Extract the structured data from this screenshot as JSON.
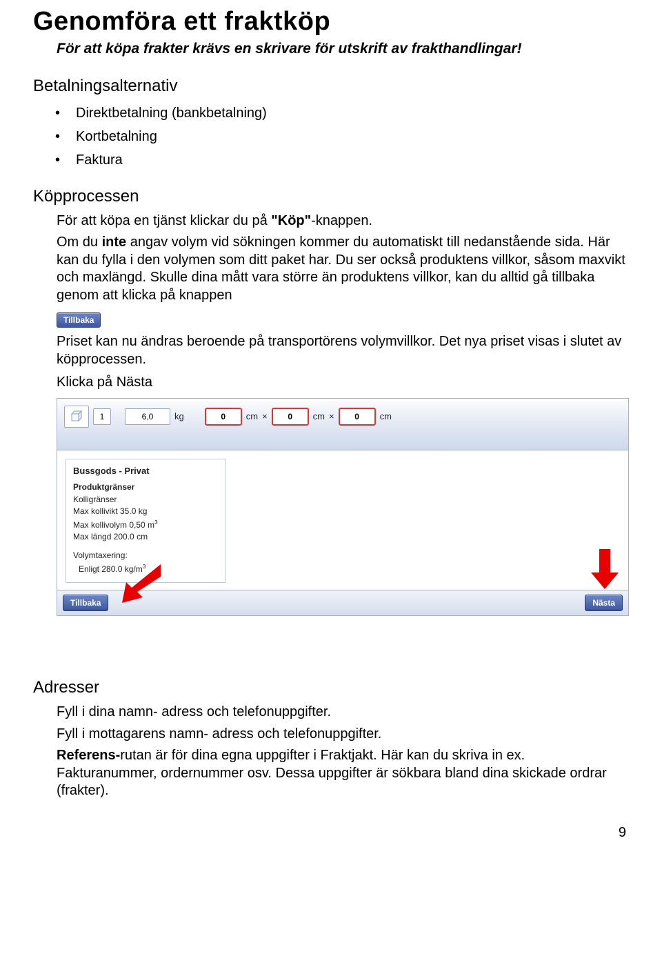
{
  "title": "Genomföra ett fraktköp",
  "subtitle": "För att köpa frakter krävs en skrivare för utskrift av frakthandlingar!",
  "section_payment": "Betalningsalternativ",
  "payment_options": [
    "Direktbetalning (bankbetalning)",
    "Kortbetalning",
    "Faktura"
  ],
  "section_process": "Köpprocessen",
  "process_p1_pre": "För att köpa en tjänst klickar du på ",
  "process_p1_key": "\"Köp\"",
  "process_p1_post": "-knappen.",
  "process_p2_pre": "Om du ",
  "process_p2_bold": "inte",
  "process_p2_post": " angav volym vid sökningen kommer du automatiskt till nedanstående sida. Här kan du fylla i den volymen som ditt paket har. Du ser också produktens villkor, såsom maxvikt och maxlängd. Skulle dina mått vara större än produktens villkor, kan du alltid gå tillbaka genom att klicka på knappen",
  "btn_back": "Tillbaka",
  "process_p3": "Priset kan nu ändras beroende på transportörens volymvillkor. Det nya priset visas i slutet av köpprocessen.",
  "process_p4": "Klicka på Nästa",
  "panel": {
    "qty": "1",
    "weight": "6,0",
    "unit_kg": "kg",
    "dim": "0",
    "unit_cm": "cm",
    "times": "×",
    "product_title": "Bussgods - Privat",
    "limits_header": "Produktgränser",
    "kolli_label": "Kolligränser",
    "max_weight": "Max kollivikt 35.0 kg",
    "max_volume_pre": "Max kollivolym 0,50 m",
    "max_volume_sup": "3",
    "max_length": "Max längd 200.0 cm",
    "vol_label": "Volymtaxering:",
    "vol_value_pre": "Enligt 280.0 kg/m",
    "vol_value_sup": "3",
    "btn_back": "Tillbaka",
    "btn_next": "Nästa"
  },
  "section_addresses": "Adresser",
  "addr_p1": "Fyll i dina namn- adress och telefonuppgifter.",
  "addr_p2": "Fyll i mottagarens namn- adress och telefonuppgifter.",
  "addr_p3_bold": "Referens-",
  "addr_p3_post": "rutan är för dina egna uppgifter i Fraktjakt. Här kan du skriva in ex. Fakturanummer, ordernummer osv. Dessa uppgifter är sökbara bland dina skickade ordrar (frakter).",
  "page_number": "9"
}
